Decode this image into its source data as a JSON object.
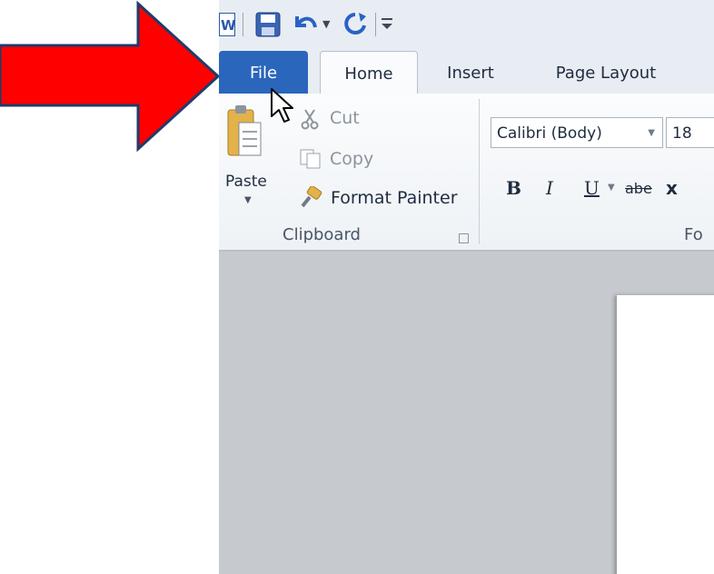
{
  "tabs": {
    "file": "File",
    "home": "Home",
    "insert": "Insert",
    "page_layout": "Page Layout"
  },
  "clipboard": {
    "paste": "Paste",
    "cut": "Cut",
    "copy": "Copy",
    "format_painter": "Format Painter",
    "group_label": "Clipboard"
  },
  "font": {
    "name": "Calibri (Body)",
    "size": "18",
    "group_label_partial": "Fo",
    "bold": "B",
    "italic": "I",
    "underline": "U",
    "strike": "abe",
    "subscript": "x"
  },
  "icons": {
    "app": "word-icon",
    "save": "save-icon",
    "undo": "undo-icon",
    "redo": "redo-icon",
    "qat_menu": "customize-menu-icon",
    "cursor": "mouse-pointer-icon",
    "arrow": "red-arrow-annotation"
  },
  "colors": {
    "file_tab": "#2a66bc",
    "arrow_fill": "#ff0000",
    "arrow_stroke": "#1f3b6b"
  }
}
